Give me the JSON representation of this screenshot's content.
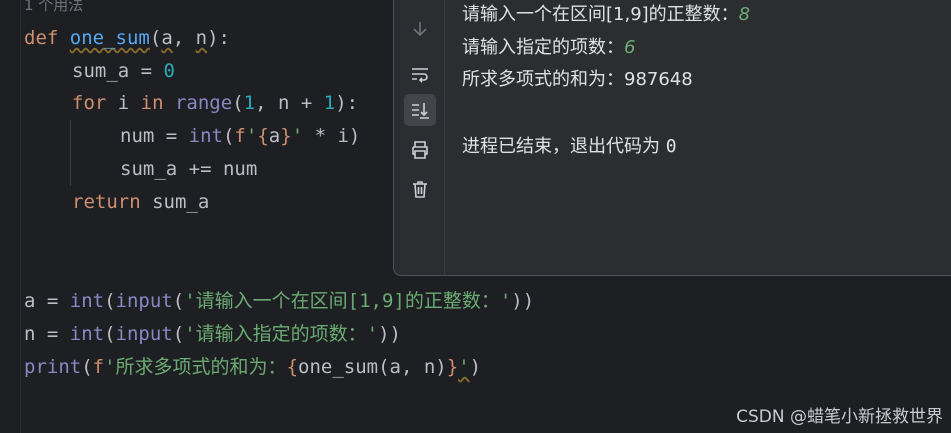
{
  "editor": {
    "usage_hint": "1 个用法",
    "lines": {
      "def_kw": "def",
      "func_name": "one_sum",
      "open": "(",
      "param_a": "a",
      "comma_sp": ", ",
      "param_n": "n",
      "close_colon": "):",
      "sum_init_lhs": "sum_a = ",
      "sum_init_val": "0",
      "for_kw": "for",
      "for_var": " i ",
      "in_kw": "in",
      "range_fn": " range",
      "range_open": "(",
      "range_1": "1",
      "range_mid": ", n + ",
      "range_2": "1",
      "range_close": "):",
      "num_lhs": "num = ",
      "num_int": "int",
      "num_open": "(",
      "num_f": "f",
      "num_q1": "'",
      "num_brace_o": "{",
      "num_a": "a",
      "num_brace_c": "}",
      "num_q2": "'",
      "num_rest": " * i)",
      "sum_add": "sum_a += num",
      "return_kw": "return",
      "return_val": " sum_a",
      "a_lhs": "a = ",
      "a_int": "int",
      "a_open": "(",
      "a_input": "input",
      "a_open2": "(",
      "a_str": "'请输入一个在区间[1,9]的正整数：'",
      "a_close": "))",
      "n_lhs": "n = ",
      "n_int": "int",
      "n_open": "(",
      "n_input": "input",
      "n_open2": "(",
      "n_str": "'请输入指定的项数：'",
      "n_close": "))",
      "p_print": "print",
      "p_open": "(",
      "p_f": "f",
      "p_str": "'所求多项式的和为：",
      "p_brace_o": "{",
      "p_call": "one_sum(a, n)",
      "p_brace_c": "}",
      "p_q": "'",
      "p_close": ")"
    }
  },
  "run_panel": {
    "output": [
      {
        "prompt": "请输入一个在区间[1,9]的正整数：",
        "value": "8"
      },
      {
        "prompt": "请输入指定的项数：",
        "value": "6"
      },
      {
        "prompt": "所求多项式的和为：",
        "value": "987648"
      }
    ],
    "exit_message": "进程已结束，退出代码为 ",
    "exit_code": "0",
    "toolbar": [
      "arrow-down-icon",
      "soft-wrap-icon",
      "scroll-to-end-icon",
      "print-icon",
      "trash-icon"
    ]
  },
  "watermark": "CSDN @蜡笔小新拯救世界",
  "colors": {
    "keyword": "#cf8e6d",
    "function": "#56a8f5",
    "builtin": "#8888c6",
    "number": "#2aacb8",
    "string": "#6aab73"
  }
}
